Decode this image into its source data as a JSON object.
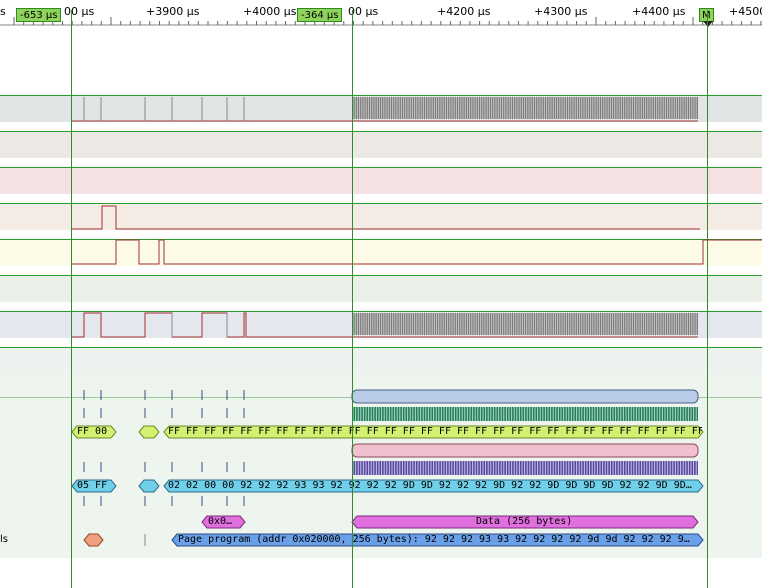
{
  "ruler": {
    "left_cut_label": "s",
    "ticks": [
      "+3900 µs",
      "+4000 µs",
      "+4200 µs",
      "+4300 µs",
      "+4400 µs",
      "+4500"
    ],
    "tick_partials": {
      "left_mid": "00 µs",
      "mid_gap": "00 µs"
    },
    "markers": {
      "left": "-653 µs",
      "middle": "-364 µs",
      "right": "M"
    }
  },
  "decoded": {
    "row1_left": "FF 00",
    "row1_right": "FF FF FF FF FF FF FF FF FF FF FF FF FF FF FF FF FF FF FF FF FF FF FF FF FF FF FF FF FF FF FF FF FF…",
    "row2_left": "05 FF",
    "row2_right": "02 02 00 00 92 92 92 93 93 92 92 92 92 9D 9D 92 92 92 9D 92 92 9D 9D 9D 9D 92 92 9D 9D…",
    "row3_small": "0x0…",
    "row3_data": "Data (256 bytes)",
    "row4_label": "ls",
    "row4_text": "Page program (addr 0x020000, 256 bytes): 92 92 92 93 93 92 92 92 92 9d 9d 92 92 92 9…"
  },
  "colors": {
    "lane_border": "#2aa02a",
    "cursor": "#2e8b2e",
    "trace": "#b03030",
    "pill_green": "#d4f070",
    "pill_cyan": "#70d0ea",
    "pill_magenta": "#e070e0",
    "pill_blue": "#6aa0e8",
    "pill_orange": "#f0a080"
  }
}
